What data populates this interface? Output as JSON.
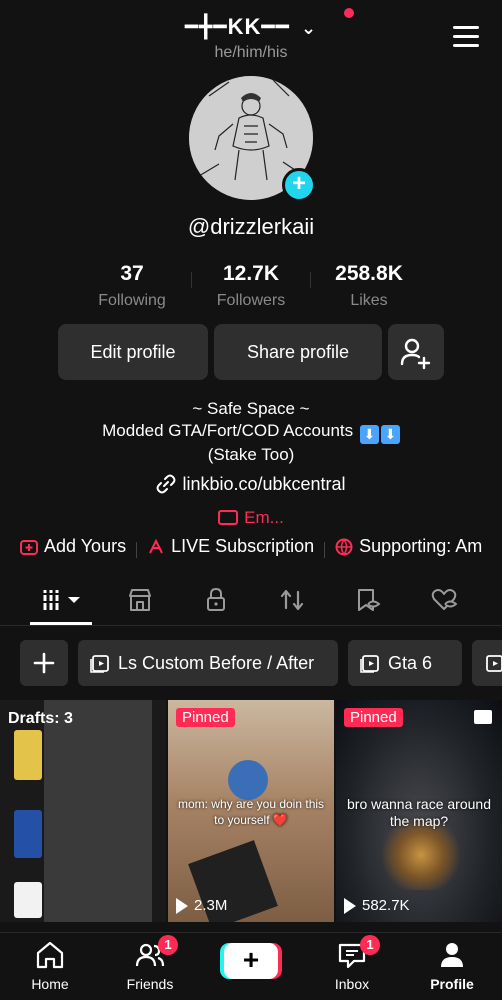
{
  "header": {
    "title": "━╋━KK━━",
    "title_chevron": "⌄",
    "pronouns": "he/him/his"
  },
  "profile": {
    "handle": "@drizzlerkaii",
    "add_avatar_symbol": "+"
  },
  "stats": [
    {
      "value": "37",
      "label": "Following"
    },
    {
      "value": "12.7K",
      "label": "Followers"
    },
    {
      "value": "258.8K",
      "label": "Likes"
    }
  ],
  "buttons": {
    "edit_profile": "Edit profile",
    "share_profile": "Share profile"
  },
  "bio": {
    "line1": "~ Safe Space ~",
    "line2": "Modded GTA/Fort/COD Accounts",
    "line2_emoji1": "⬇",
    "line2_emoji2": "⬇",
    "line3": "(Stake Too)"
  },
  "link": "linkbio.co/ubkcentral",
  "email": "Em...",
  "chips": [
    {
      "label": "Add Yours",
      "icon": "add-yours-icon"
    },
    {
      "label": "LIVE Subscription",
      "icon": "live-subscription-icon"
    },
    {
      "label": "Supporting: Am",
      "icon": "globe-heart-icon"
    }
  ],
  "playlists": [
    {
      "label": "Ls Custom Before / After"
    },
    {
      "label": "Gta 6"
    }
  ],
  "playlist_add_symbol": "+",
  "videos": [
    {
      "drafts_label": "Drafts: 3"
    },
    {
      "pinned": "Pinned",
      "caption": "mom: why are you doin this to yourself ❤️",
      "views": "2.3M"
    },
    {
      "pinned": "Pinned",
      "caption": "bro wanna race around the map?",
      "views": "582.7K"
    }
  ],
  "nav": {
    "home": "Home",
    "friends": "Friends",
    "friends_badge": "1",
    "create_symbol": "+",
    "inbox": "Inbox",
    "inbox_badge": "1",
    "profile": "Profile"
  },
  "colors": {
    "background": "#121212",
    "accent_red": "#fe2c55",
    "accent_cyan": "#20d5ec",
    "button_bg": "#2f2f2f"
  }
}
